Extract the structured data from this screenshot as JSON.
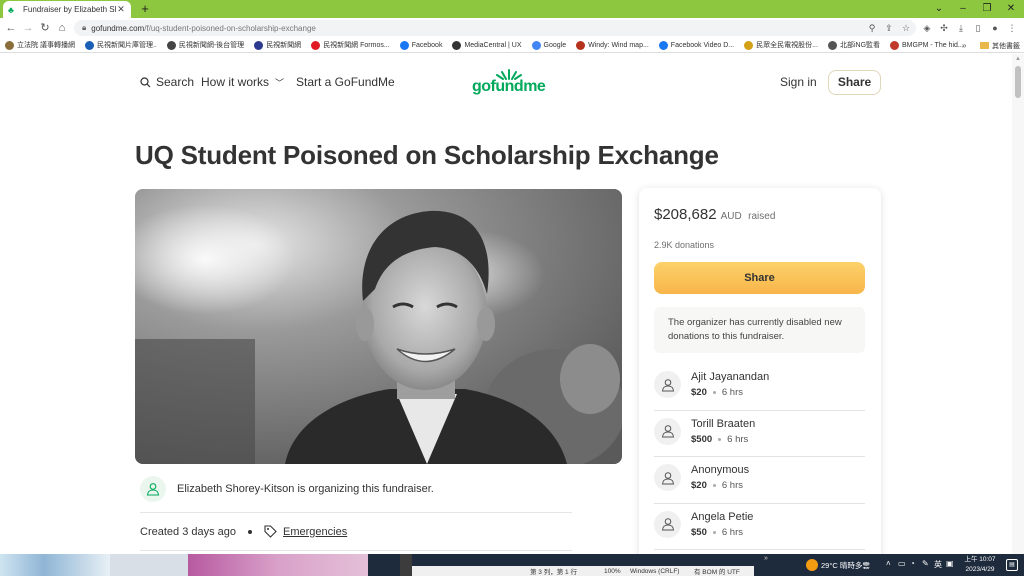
{
  "browser": {
    "tab_title": "Fundraiser by Elizabeth Shorey",
    "url_host": "gofundme.com",
    "url_path": "/f/uq-student-poisoned-on-scholarship-exchange",
    "bookmarks": [
      {
        "label": "立法院 議事轉播網",
        "color": "#8a6d3b"
      },
      {
        "label": "民視新聞片庫管理..",
        "color": "#1a5fb4"
      },
      {
        "label": "民視新聞網-後台管理",
        "color": "#444"
      },
      {
        "label": "民視新聞網",
        "color": "#2b3a8f"
      },
      {
        "label": "民視新聞網 Formos...",
        "color": "#e01b24"
      },
      {
        "label": "Facebook",
        "color": "#1877f2"
      },
      {
        "label": "MediaCentral | UX",
        "color": "#333"
      },
      {
        "label": "Google",
        "color": "#4285f4"
      },
      {
        "label": "Windy: Wind map...",
        "color": "#b5331c"
      },
      {
        "label": "Facebook Video D...",
        "color": "#1877f2"
      },
      {
        "label": "民眾全民電視股份...",
        "color": "#d4a017"
      },
      {
        "label": "北部iNG監看",
        "color": "#555"
      },
      {
        "label": "BMGPM - The hid...",
        "color": "#c0392b"
      }
    ],
    "bookmarks_more": "»",
    "bookmarks_other": "其他書籤"
  },
  "site": {
    "nav": {
      "search": "Search",
      "how_it_works": "How it works",
      "start": "Start a GoFundMe",
      "logo": "gofundme",
      "sign_in": "Sign in",
      "share": "Share"
    },
    "title": "UQ Student Poisoned on Scholarship Exchange",
    "organizer_text": "Elizabeth Shorey-Kitson is organizing this fundraiser.",
    "created": "Created 3 days ago",
    "category": "Emergencies"
  },
  "card": {
    "amount": "$208,682",
    "currency": "AUD",
    "raised_label": "raised",
    "donations_count": "2.9K donations",
    "share_label": "Share",
    "disabled_note": "The organizer has currently disabled new donations to this fundraiser.",
    "donors": [
      {
        "name": "Ajit Jayanandan",
        "amount": "$20",
        "time": "6 hrs"
      },
      {
        "name": "Torill Braaten",
        "amount": "$500",
        "time": "6 hrs"
      },
      {
        "name": "Anonymous",
        "amount": "$20",
        "time": "6 hrs"
      },
      {
        "name": "Angela Petie",
        "amount": "$50",
        "time": "6 hrs"
      }
    ]
  },
  "taskbar": {
    "status_position": "第 3 列，第 1 行",
    "status_zoom": "100%",
    "status_eol": "Windows (CRLF)",
    "status_encoding": "有 BOM 的 UTF",
    "weather": "29°C 晴時多雲",
    "ime": "英",
    "time": "上午 10:07",
    "date": "2023/4/29"
  },
  "colors": {
    "brand_green": "#02a95c",
    "share_yellow": "#fbc55a",
    "tab_bar": "#8dc63f"
  }
}
